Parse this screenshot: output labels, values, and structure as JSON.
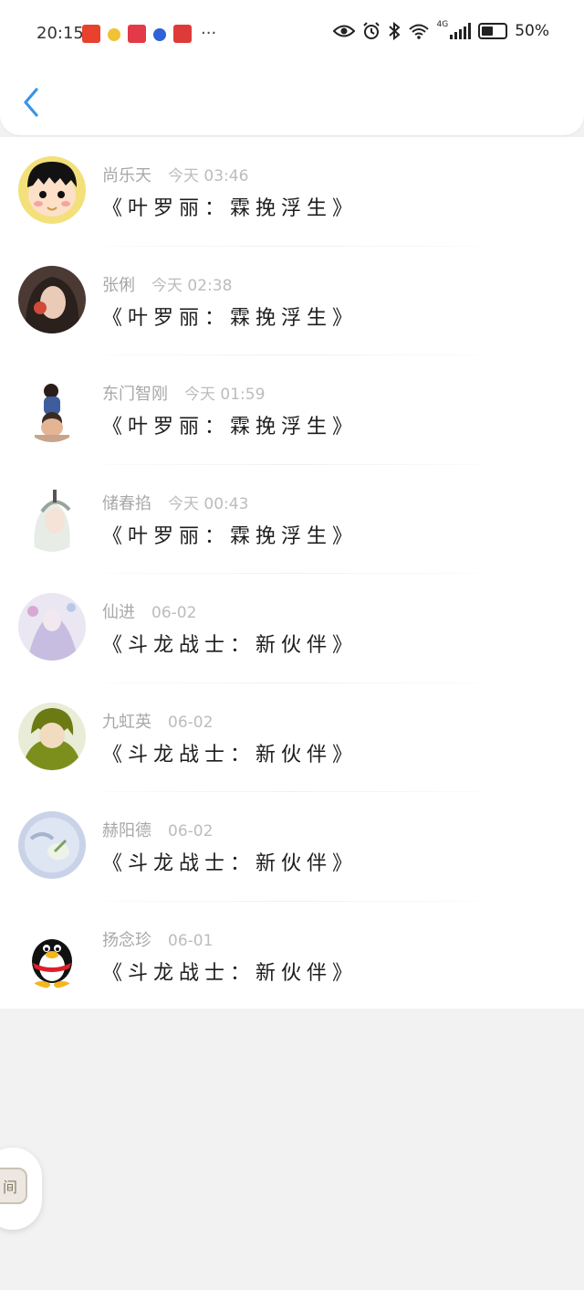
{
  "status_bar": {
    "time": "20:15",
    "battery": "50%",
    "network": "4G",
    "icons": [
      "eye-icon",
      "alarm-icon",
      "bluetooth-icon",
      "wifi-icon",
      "signal-icon",
      "battery-icon"
    ],
    "more": "···"
  },
  "header": {
    "back_icon": "chevron-left-icon",
    "accent_color": "#3b94e6"
  },
  "comments": [
    {
      "name": "尚乐天",
      "time": "今天 03:46",
      "title": "《叶罗丽：霖挽浮生》"
    },
    {
      "name": "张俐",
      "time": "今天 02:38",
      "title": "《叶罗丽：霖挽浮生》"
    },
    {
      "name": "东门智刚",
      "time": "今天 01:59",
      "title": "《叶罗丽：霖挽浮生》"
    },
    {
      "name": "储春掐",
      "time": "今天 00:43",
      "title": "《叶罗丽：霖挽浮生》"
    },
    {
      "name": "仙进",
      "time": "06-02",
      "title": "《斗龙战士：新伙伴》"
    },
    {
      "name": "九虹英",
      "time": "06-02",
      "title": "《斗龙战士：新伙伴》"
    },
    {
      "name": "赫阳德",
      "time": "06-02",
      "title": "《斗龙战士：新伙伴》"
    },
    {
      "name": "扬念珍",
      "time": "06-01",
      "title": "《斗龙战士：新伙伴》"
    }
  ],
  "float_button": {
    "label": "间"
  }
}
